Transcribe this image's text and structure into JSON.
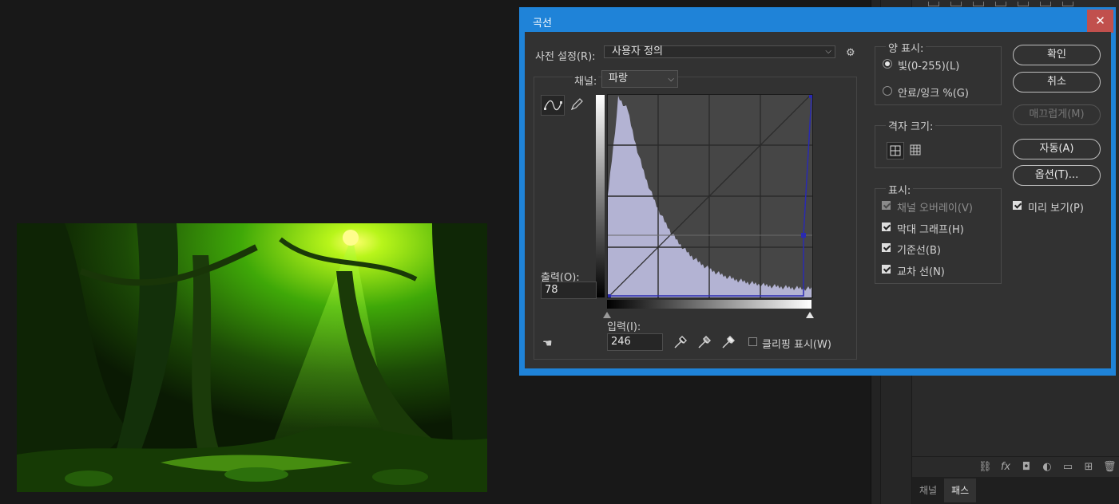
{
  "dialog": {
    "title": "곡선",
    "close_label": "✕"
  },
  "preset": {
    "label": "사전 설정(R):",
    "value": "사용자 정의"
  },
  "channel": {
    "label": "채널:",
    "value": "파랑"
  },
  "output": {
    "label": "출력(O):",
    "value": "78"
  },
  "input": {
    "label": "입력(I):",
    "value": "246"
  },
  "clipping": {
    "label": "클리핑 표시(W)",
    "checked": false
  },
  "amount_display": {
    "title": "양 표시:",
    "options": [
      {
        "label": "빛(0-255)(L)",
        "selected": true
      },
      {
        "label": "안료/잉크 %(G)",
        "selected": false
      }
    ]
  },
  "grid_size": {
    "title": "격자 크기:",
    "selected": "simple"
  },
  "show": {
    "title": "표시:",
    "items": [
      {
        "label": "채널 오버레이(V)",
        "checked": true,
        "enabled": false
      },
      {
        "label": "막대 그래프(H)",
        "checked": true,
        "enabled": true
      },
      {
        "label": "기준선(B)",
        "checked": true,
        "enabled": true
      },
      {
        "label": "교차 선(N)",
        "checked": true,
        "enabled": true
      }
    ]
  },
  "buttons": {
    "ok": "확인",
    "cancel": "취소",
    "smooth": "매끄럽게(M)",
    "auto": "자동(A)",
    "options": "옵션(T)..."
  },
  "preview": {
    "label": "미리 보기(P)",
    "checked": true
  },
  "panel_tabs": [
    "채널",
    "패스"
  ],
  "active_tab": "패스",
  "colors": {
    "dialog_border": "#1f83d8",
    "close_button": "#c1504d",
    "histogram": "#b3b3d3",
    "curve": "#2a2ab0"
  }
}
